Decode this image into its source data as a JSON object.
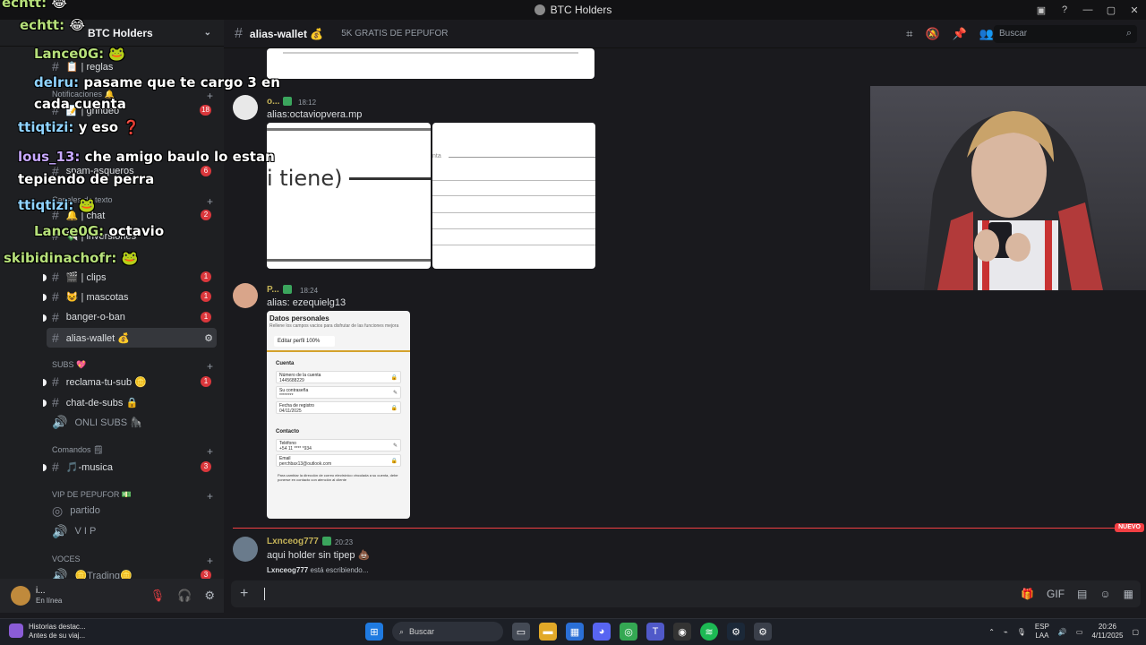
{
  "window": {
    "title": "BTC Holders",
    "controls": [
      "—",
      "▢",
      "✕"
    ]
  },
  "server": {
    "name": "BTC Holders"
  },
  "sidebar": {
    "channels": [
      {
        "label": "📋 | reglas",
        "badge": ""
      },
      {
        "label": "📝 | grindeo",
        "badge": "18"
      },
      {
        "label": "🔔 | chat",
        "badge": "2"
      },
      {
        "label": "💸 | inversiones",
        "badge": ""
      },
      {
        "label": "🎬 | clips",
        "badge": "1"
      },
      {
        "label": "😺 | mascotas",
        "badge": "1"
      },
      {
        "label": "banger-o-ban",
        "badge": "1"
      },
      {
        "label": "alias-wallet 💰",
        "badge": ""
      },
      {
        "label": "reclama-tu-sub 🪙",
        "badge": "1"
      },
      {
        "label": "chat-de-subs 🔒",
        "badge": ""
      },
      {
        "label": "ONLI SUBS 🦍",
        "badge": ""
      },
      {
        "label": "🎵-musica",
        "badge": "3"
      },
      {
        "label": "partido",
        "badge": ""
      },
      {
        "label": "V I P",
        "badge": ""
      },
      {
        "label": "🪙Trading🪙",
        "badge": "3"
      }
    ],
    "categories": [
      "Notificaciones 🔔",
      "Canales de texto",
      "SUBS 💖",
      "Comandos 🗒",
      "VIP DE PEPUFOR 💵",
      "VOCES"
    ],
    "spam_label": "spam-asqueros",
    "spam_badge": "6"
  },
  "overlay_chat": [
    {
      "name": "echtt:",
      "text": "😂"
    },
    {
      "name": "echtt:",
      "text": "😂"
    },
    {
      "name": "Lance0G:",
      "text": "🐸"
    },
    {
      "name": "delru:",
      "text": "pasame que te cargo 3 en cada cuenta"
    },
    {
      "name": "ttiqtizi:",
      "text": "y eso ❓"
    },
    {
      "name": "lous_13:",
      "text": "che amigo baulo lo estan tepiendo de perra"
    },
    {
      "name": "ttiqtizi:",
      "text": "🐸"
    },
    {
      "name": "Lance0G:",
      "text": "octavio"
    },
    {
      "name": "skibidinachofr:",
      "text": "🐸"
    }
  ],
  "user_panel": {
    "name": "i...",
    "status": "En línea"
  },
  "header": {
    "channel": "alias-wallet 💰",
    "topic": "5K GRATIS DE PEPUFOR",
    "search_placeholder": "Buscar"
  },
  "messages": [
    {
      "author": "o...",
      "time": "18:12",
      "text": "alias:octaviopvera.mp",
      "image_caption": "i tiene)",
      "image_caption2": "nta"
    },
    {
      "author": "P...",
      "time": "18:24",
      "text": "alias: ezequielg13"
    },
    {
      "author": "Lxnceog777",
      "time": "20:23",
      "text": "aqui holder sin tipep 💩"
    }
  ],
  "form_shot": {
    "title": "Datos personales",
    "subtitle": "Rellene los campos vacios para disfrutar de las funciones mejora",
    "tab": "Editar perfil 100%",
    "section_account": "Cuenta",
    "fields": [
      {
        "label": "Número de la cuenta",
        "value": "1445688229"
      },
      {
        "label": "Su contraseña",
        "value": "********"
      },
      {
        "label": "Fecha de registro",
        "value": "04/11/2025"
      }
    ],
    "section_contact": "Contacto",
    "contact_fields": [
      {
        "label": "Teléfono",
        "value": "+54 11 **** *934"
      },
      {
        "label": "Email",
        "value": "perchbax13@outlook.com"
      }
    ],
    "note": "Para cambiar la dirección de correo electrónico vinculada a su cuenta, debe ponerse en contacto con atención al cliente"
  },
  "new_badge": "NUEVO",
  "typing": {
    "user": "Lxnceog777",
    "text": "está escribiendo..."
  },
  "taskbar": {
    "widget_title": "Historias destac...",
    "widget_sub": "Antes de su viaj...",
    "search": "Buscar",
    "lang": "ESP",
    "lang2": "LAA",
    "time": "20:26",
    "date": "4/11/2025"
  }
}
